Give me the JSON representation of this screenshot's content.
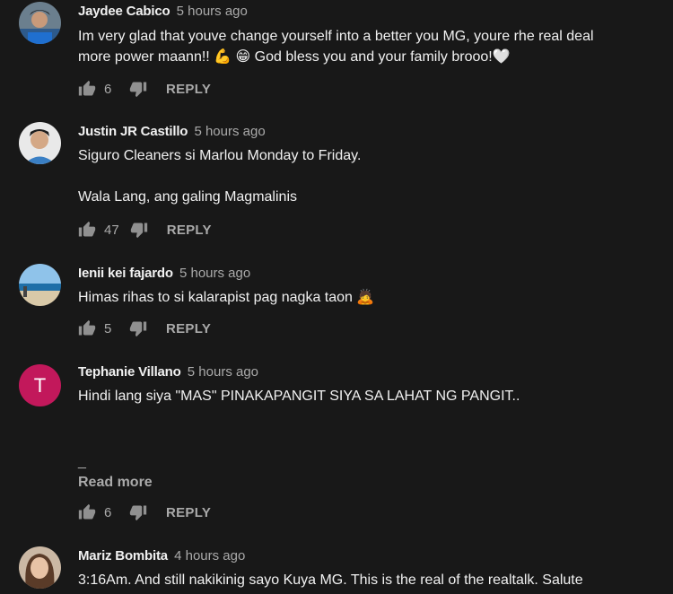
{
  "comments": [
    {
      "author": "Jaydee Cabico",
      "time": "5 hours ago",
      "text": "Im very glad that youve change yourself into a better you MG, youre rhe real deal\nmore power maann!! 💪 😁 God bless you and your family brooo!🤍",
      "likes": "6",
      "reply": "REPLY",
      "avatar": "photo"
    },
    {
      "author": "Justin JR Castillo",
      "time": "5 hours ago",
      "text": "Siguro Cleaners si Marlou Monday to Friday.\n\nWala Lang, ang galing Magmalinis",
      "likes": "47",
      "reply": "REPLY",
      "avatar": "photo"
    },
    {
      "author": "Ienii kei fajardo",
      "time": "5 hours ago",
      "text": "Himas rihas to si kalarapist pag nagka taon 🙇",
      "likes": "5",
      "reply": "REPLY",
      "avatar": "photo"
    },
    {
      "author": "Tephanie Villano",
      "time": "5 hours ago",
      "text": "Hindi lang siya \"MAS\" PINAKAPANGIT SIYA SA LAHAT NG PANGIT..",
      "extra_line": "_",
      "read_more": "Read more",
      "likes": "6",
      "reply": "REPLY",
      "avatar_letter": "T",
      "avatar_color": "#c2185b"
    },
    {
      "author": "Mariz Bombita",
      "time": "4 hours ago",
      "text": "3:16Am. And still nakikinig sayo Kuya MG. This is the real of the realtalk. Salute",
      "avatar": "photo"
    }
  ],
  "icons": {
    "like": "thumb-up-icon",
    "dislike": "thumb-down-icon"
  },
  "colors": {
    "background": "#181818",
    "text": "#f1f1f1",
    "secondary": "#aaaaaa"
  }
}
